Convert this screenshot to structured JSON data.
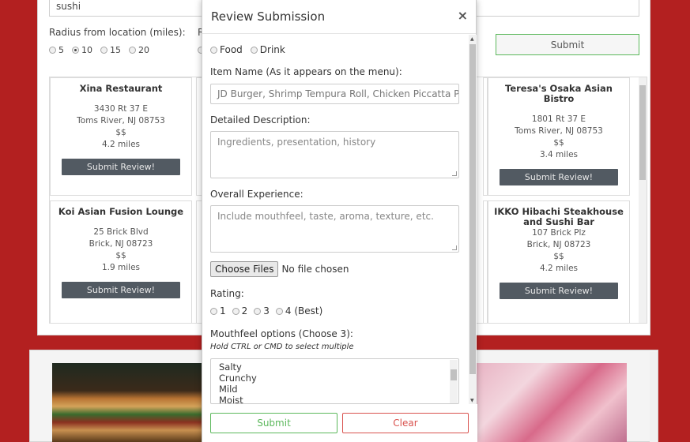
{
  "search": {
    "value": "sushi"
  },
  "radius": {
    "label": "Radius from location (miles):",
    "label2_partial": "R",
    "options": [
      "5",
      "10",
      "15",
      "20"
    ],
    "selected": "10"
  },
  "top_submit_label": "Submit",
  "review_button_label": "Submit Review!",
  "restaurants": [
    {
      "name": "Xina Restaurant",
      "address": "3430 Rt 37 E",
      "city": "Toms River, NJ 08753",
      "price": "$$",
      "distance": "4.2 miles"
    },
    {
      "name": "Teresa's Osaka Asian Bistro",
      "address": "1801 Rt 37 E",
      "city": "Toms River, NJ 08753",
      "price": "$$",
      "distance": "3.4 miles"
    },
    {
      "name": "Koi Asian Fusion Lounge",
      "address": "25 Brick Blvd",
      "city": "Brick, NJ 08723",
      "price": "$$",
      "distance": "1.9 miles"
    },
    {
      "name": "IKKO Hibachi Steakhouse and Sushi Bar",
      "address": "107 Brick Plz",
      "city": "Brick, NJ 08723",
      "price": "$$",
      "distance": "4.2 miles"
    }
  ],
  "modal": {
    "title": "Review Submission",
    "close": "×",
    "type_options": [
      "Food",
      "Drink"
    ],
    "item_name_label": "Item Name (As it appears on the menu):",
    "item_name_placeholder": "JD Burger, Shrimp Tempura Roll, Chicken Piccatta Pasta",
    "description_label": "Detailed Description:",
    "description_placeholder": "Ingredients, presentation, history",
    "experience_label": "Overall Experience:",
    "experience_placeholder": "Include mouthfeel, taste, aroma, texture, etc.",
    "file_button": "Choose Files",
    "file_status": "No file chosen",
    "rating_label": "Rating:",
    "rating_options": [
      "1",
      "2",
      "3",
      "4 (Best)"
    ],
    "mouthfeel_label": "Mouthfeel options (Choose 3):",
    "mouthfeel_hint": "Hold CTRL or CMD to select multiple",
    "mouthfeel_options": [
      "Salty",
      "Crunchy",
      "Mild",
      "Moist"
    ],
    "submit_label": "Submit",
    "clear_label": "Clear"
  },
  "colors": {
    "background": "#b32020",
    "success": "#5cb85c",
    "danger": "#d9534f",
    "card_button": "#525a62"
  }
}
